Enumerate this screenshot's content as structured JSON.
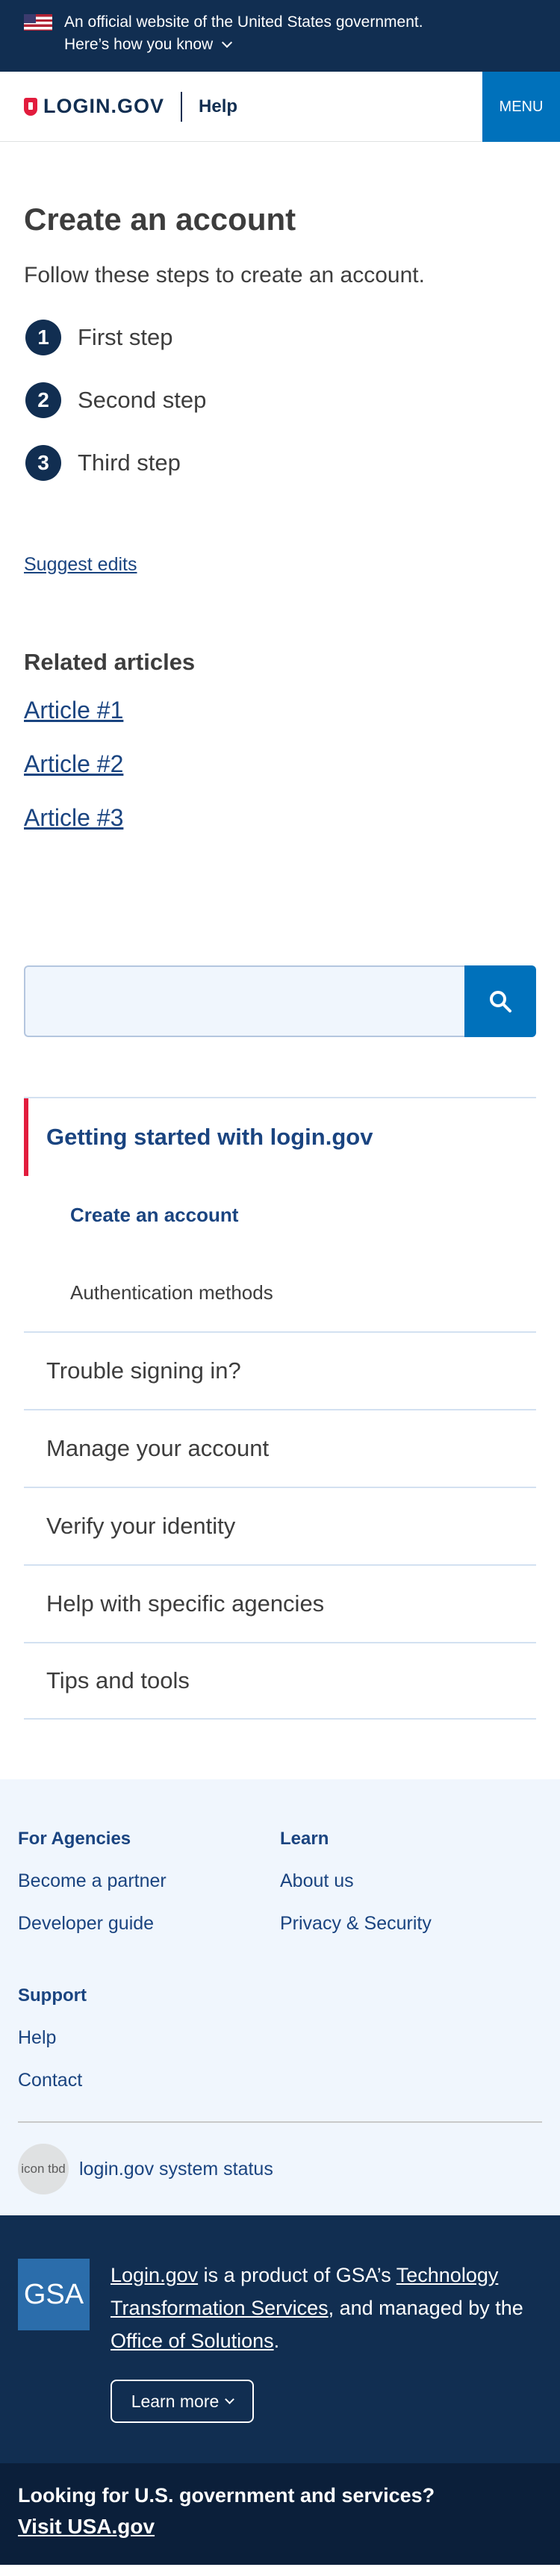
{
  "gov_banner": {
    "official_text": "An official website of the United States government.",
    "how_link": "Here’s how you know"
  },
  "header": {
    "logo_text": "LOGIN.GOV",
    "help_link": "Help",
    "menu_label": "MENU"
  },
  "main": {
    "title": "Create an account",
    "lead": "Follow these steps to create an account.",
    "steps": [
      {
        "num": "1",
        "label": "First step"
      },
      {
        "num": "2",
        "label": "Second step"
      },
      {
        "num": "3",
        "label": "Third step"
      }
    ],
    "suggest_edits": "Suggest edits",
    "related_heading": "Related articles",
    "articles": [
      "Article #1",
      "Article #2",
      "Article #3"
    ]
  },
  "search": {
    "value": "",
    "placeholder": ""
  },
  "sidenav": {
    "section_title": "Getting started with login.gov",
    "subitems": [
      {
        "label": "Create an account",
        "active": true
      },
      {
        "label": "Authentication methods",
        "active": false
      }
    ],
    "items": [
      "Trouble signing in?",
      "Manage your account",
      "Verify your identity",
      "Help with specific agencies",
      "Tips and tools"
    ]
  },
  "footer": {
    "agencies_heading": "For Agencies",
    "agencies_links": [
      "Become a partner",
      "Developer guide"
    ],
    "learn_heading": "Learn",
    "learn_links": [
      "About us",
      "Privacy & Security"
    ],
    "support_heading": "Support",
    "support_links": [
      "Help",
      "Contact"
    ],
    "status_icon_text": "icon tbd",
    "status_link": "login.gov system status"
  },
  "gsa": {
    "logo_text": "GSA",
    "link_login": "Login.gov",
    "text_1": " is a product of GSA’s ",
    "link_tts": "Technology Transformation Services",
    "text_2": ", and managed by the ",
    "link_solutions": "Office of Solutions",
    "text_3": ".",
    "learn_more": "Learn more"
  },
  "usa": {
    "question": "Looking for U.S. government and services?",
    "link": "Visit USA.gov"
  },
  "colors": {
    "navy": "#112e51",
    "primary_blue": "#0071bb",
    "link_blue": "#1a4480",
    "accent_red": "#e21c3d",
    "footer_bg": "#f0f6fd"
  }
}
